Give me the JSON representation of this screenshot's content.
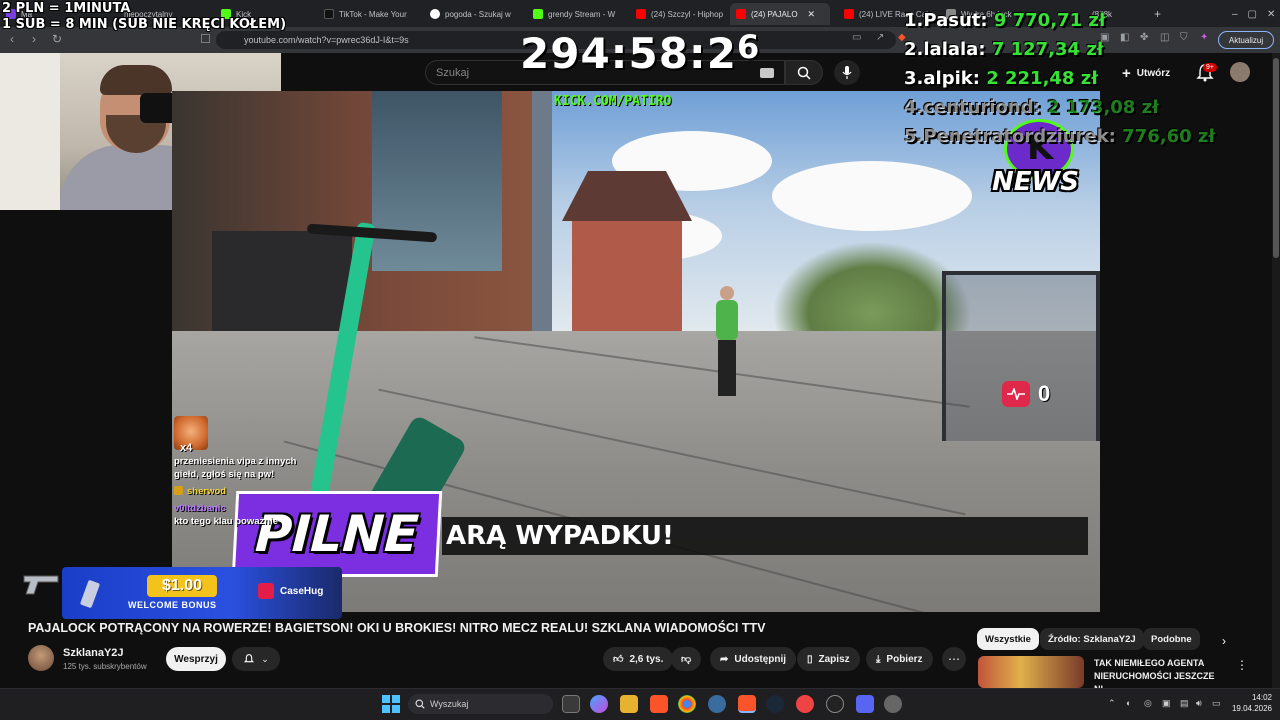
{
  "overlay_info": {
    "line1": "2 PLN =  1MINUTA",
    "line2": "1 SUB = 8 MIN (SUB NIE KRĘCI KOŁEM)"
  },
  "timer": {
    "main": "294:58:2",
    "superscript": "6"
  },
  "leaderboard": [
    {
      "rank": "1.",
      "name": "Pasut:",
      "amount": "9 770,71 zł"
    },
    {
      "rank": "2.",
      "name": "lalala:",
      "amount": "7 127,34 zł"
    },
    {
      "rank": "3.",
      "name": "alpik:",
      "amount": "2 221,48 zł"
    },
    {
      "rank": "4.",
      "name": "centuriond:",
      "amount": "2 173,08 zł"
    },
    {
      "rank": "5.",
      "name": "Penetratordziurek:",
      "amount": "776,60 zł"
    }
  ],
  "browser": {
    "tabs": [
      {
        "title": "Kick",
        "color": "#53fc18"
      },
      {
        "title": "TikTok - Make Your",
        "color": "#111111"
      },
      {
        "title": "pogoda - Szukaj w",
        "color": "#4285f4"
      },
      {
        "title": "grendy Stream - W",
        "color": "#53fc18"
      },
      {
        "title": "(24) Szczyl - Hiphop",
        "color": "#ff0000"
      },
      {
        "title": "(24) PAJALO",
        "color": "#ff0000"
      },
      {
        "title": "(24) LIVE Race Cal",
        "color": "#ff0000"
      },
      {
        "title": "Wydra 6h lock",
        "color": "#888888"
      },
      {
        "title": "(878k",
        "color": "#888888"
      }
    ],
    "partial_tab": "niepoczytalny",
    "partial_tab_left": "Ma",
    "url": "youtube.com/watch?v=pwrec36dJ-I&t=9s",
    "update_button": "Aktualizuj"
  },
  "youtube": {
    "search_placeholder": "Szukaj",
    "create_label": "Utwórz",
    "notifications_badge": "9+"
  },
  "stream_overlay": {
    "kick_url": "KICK.COM/PATIRO",
    "news_logo_letter": "K",
    "news_logo_word": "NEWS",
    "heart_count": "0",
    "breaking_label": "PILNE",
    "ticker_text": "ARĄ WYPADKU!"
  },
  "chat": {
    "emote_multiplier": "x4",
    "message1": "przeniesienia vipa z innych giełd, zgłoś się na pw!",
    "user1": "sherwod",
    "user2": "v0ltdzbanic",
    "message2": "kto tego klau poważnie"
  },
  "sponsor": {
    "amount": "$1.00",
    "label": "WELCOME BONUS",
    "brand": "CaseHug"
  },
  "video": {
    "title": "PAJALOCK POTRĄCONY NA ROWERZE! BAGIETSON! OKI U BROKIES! NITRO MECZ REALU! SZKLANA WIADOMOŚCI TTV",
    "channel_name": "SzklanaY2J",
    "subscribers": "125 tys. subskrybentów",
    "support_button": "Wesprzyj",
    "likes": "2,6 tys.",
    "share": "Udostępnij",
    "save": "Zapisz",
    "download": "Pobierz"
  },
  "sidebar": {
    "chips": [
      "Wszystkie",
      "Źródło: SzklanaY2J",
      "Podobne"
    ],
    "rec_title": "TAK NIEMIŁEGO AGENTA NIERUCHOMOŚCI JESZCZE NI..."
  },
  "taskbar": {
    "search_placeholder": "Wyszukaj",
    "time": "14:02",
    "date": "19.04.2026"
  }
}
